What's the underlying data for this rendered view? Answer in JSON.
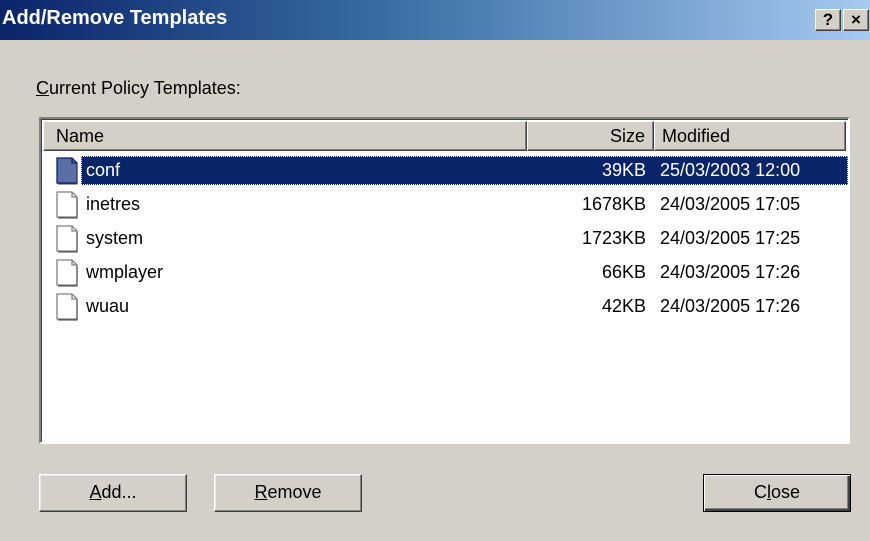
{
  "window": {
    "title": "Add/Remove Templates",
    "help_button": "?",
    "close_button": "×"
  },
  "list": {
    "label_mnemonic": "C",
    "label_rest": "urrent Policy Templates:",
    "columns": {
      "name": "Name",
      "size": "Size",
      "modified": "Modified"
    },
    "rows": [
      {
        "icon": "document-icon",
        "name": "conf",
        "size": "39KB",
        "modified": "25/03/2003 12:00",
        "selected": true
      },
      {
        "icon": "document-icon",
        "name": "inetres",
        "size": "1678KB",
        "modified": "24/03/2005 17:05",
        "selected": false
      },
      {
        "icon": "document-icon",
        "name": "system",
        "size": "1723KB",
        "modified": "24/03/2005 17:25",
        "selected": false
      },
      {
        "icon": "document-icon",
        "name": "wmplayer",
        "size": "66KB",
        "modified": "24/03/2005 17:26",
        "selected": false
      },
      {
        "icon": "document-icon",
        "name": "wuau",
        "size": "42KB",
        "modified": "24/03/2005 17:26",
        "selected": false
      }
    ]
  },
  "buttons": {
    "add": {
      "mnemonic": "A",
      "rest": "dd..."
    },
    "remove": {
      "mnemonic": "R",
      "rest": "emove"
    },
    "close": {
      "pre": "C",
      "mnemonic": "l",
      "rest": "ose"
    }
  },
  "colors": {
    "selection": "#0a246a",
    "titlebar_start": "#0a246a",
    "titlebar_end": "#a6caf0",
    "dialog_face": "#d4d0c8"
  }
}
